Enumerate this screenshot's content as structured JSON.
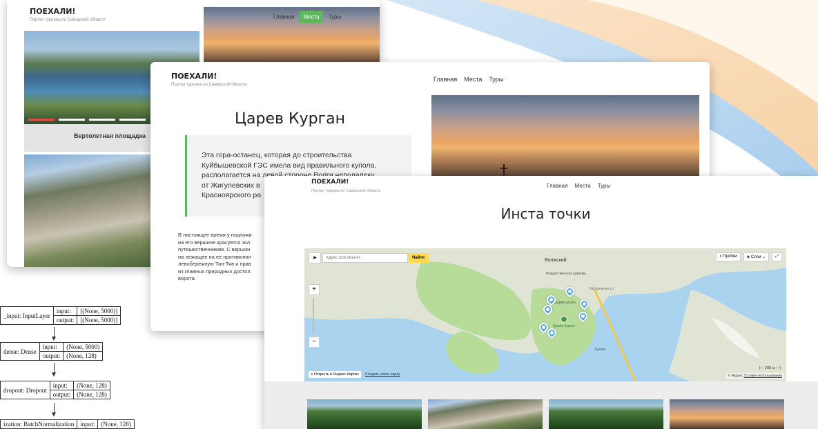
{
  "site": {
    "logo": "ПОЕХАЛИ!",
    "tagline": "Портал туризма по Самарской области",
    "nav": [
      "Главная",
      "Места",
      "Туры"
    ],
    "accent": "#5cb85c"
  },
  "back_card": {
    "active_nav": "Места",
    "caption": "Вертолетная площадка"
  },
  "middle_card": {
    "title": "Царев Курган",
    "quote": "Эта гора-останец, которая до строительства Куйбышевской ГЭС имела вид правильного купола, располагается на левой стороне Волги неподалеку от Жигулевских в... Красноярского ра...",
    "quote_lines": [
      "Эта гора-останец, которая до строительства",
      "Куйбышевской ГЭС имела вид правильного купола,",
      "располагается на левой стороне Волги неподалеку",
      "от Жигулевских в",
      "Красноярского ра"
    ],
    "body_lines": [
      "В настоящее время у подножи",
      "на его вершине красуется зол",
      "путешественникам. С вершин",
      "на лежащее на ее противопол",
      "левобережную Тип-Тяв и прав",
      "из главных природных достоп",
      "ворота."
    ]
  },
  "front_card": {
    "logo": "ПОЕХАЛИ!",
    "title": "Инста точки",
    "map": {
      "search_placeholder": "Адрес или объект",
      "search_button": "Найти",
      "traffic_label": "Пробки",
      "layers_label": "Слои",
      "open_in_yandex": "Открыть в Яндекс.Картах",
      "create_map": "Создать свою карту",
      "scale": "200 м",
      "copyright": "© Яндекс",
      "terms": "Условия использования",
      "place_labels": [
        "Волжский",
        "Рождественская церковь",
        "Царёв курган",
        "Царёв Курган",
        "Лукойл",
        "Набережная ул."
      ],
      "zoom_in": "+",
      "zoom_out": "−"
    }
  },
  "nn_diagram": {
    "layers": [
      {
        "name": "_input: InputLayer",
        "input": "[(None, 5000)]",
        "output": "[(None, 5000)]"
      },
      {
        "name": "dense: Dense",
        "input": "(None, 5000)",
        "output": "(None, 128)"
      },
      {
        "name": "dropout: Dropout",
        "input": "(None, 128)",
        "output": "(None, 128)"
      },
      {
        "name": "ization: BatchNormalization",
        "input": "(None, 128)",
        "output": ""
      }
    ],
    "input_label": "input:",
    "output_label": "output:"
  }
}
